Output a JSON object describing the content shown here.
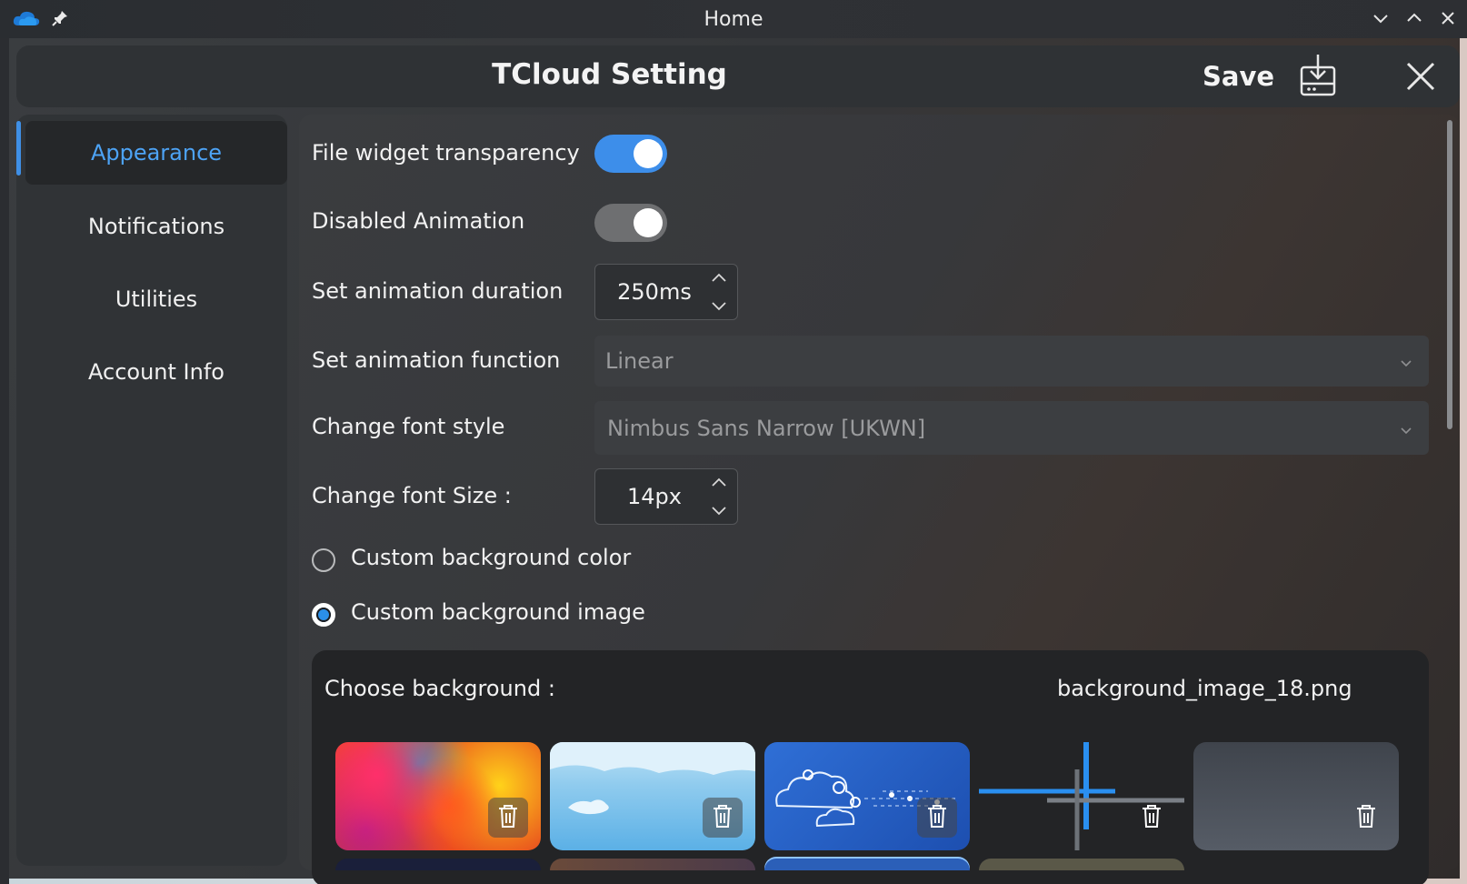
{
  "window": {
    "title": "Home"
  },
  "header": {
    "title": "TCloud Setting",
    "save_label": "Save"
  },
  "sidebar": {
    "items": [
      {
        "label": "Appearance",
        "active": true
      },
      {
        "label": "Notifications",
        "active": false
      },
      {
        "label": "Utilities",
        "active": false
      },
      {
        "label": "Account Info",
        "active": false
      }
    ]
  },
  "settings": {
    "file_widget_transparency": {
      "label": "File widget transparency",
      "enabled": true
    },
    "disabled_animation": {
      "label": "Disabled Animation",
      "enabled": false
    },
    "animation_duration": {
      "label": "Set animation duration",
      "value": "250ms"
    },
    "animation_function": {
      "label": "Set animation function",
      "value": "Linear"
    },
    "font_style": {
      "label": "Change font style",
      "value": "Nimbus Sans Narrow [UKWN]"
    },
    "font_size": {
      "label": "Change font Size :",
      "value": "14px"
    },
    "background_mode": {
      "options": [
        {
          "label": "Custom background color",
          "selected": false
        },
        {
          "label": "Custom background image",
          "selected": true
        }
      ]
    },
    "background_chooser": {
      "label": "Choose background :",
      "selected_file": "background_image_18.png"
    }
  },
  "colors": {
    "accent": "#3d8eea",
    "active_text": "#4da3f5"
  },
  "icons": [
    "onedrive-cloud-icon",
    "pin-icon",
    "minimize-chevron-icon",
    "maximize-chevron-icon",
    "close-icon",
    "save-download-icon",
    "trash-icon",
    "chevron-down-icon"
  ]
}
